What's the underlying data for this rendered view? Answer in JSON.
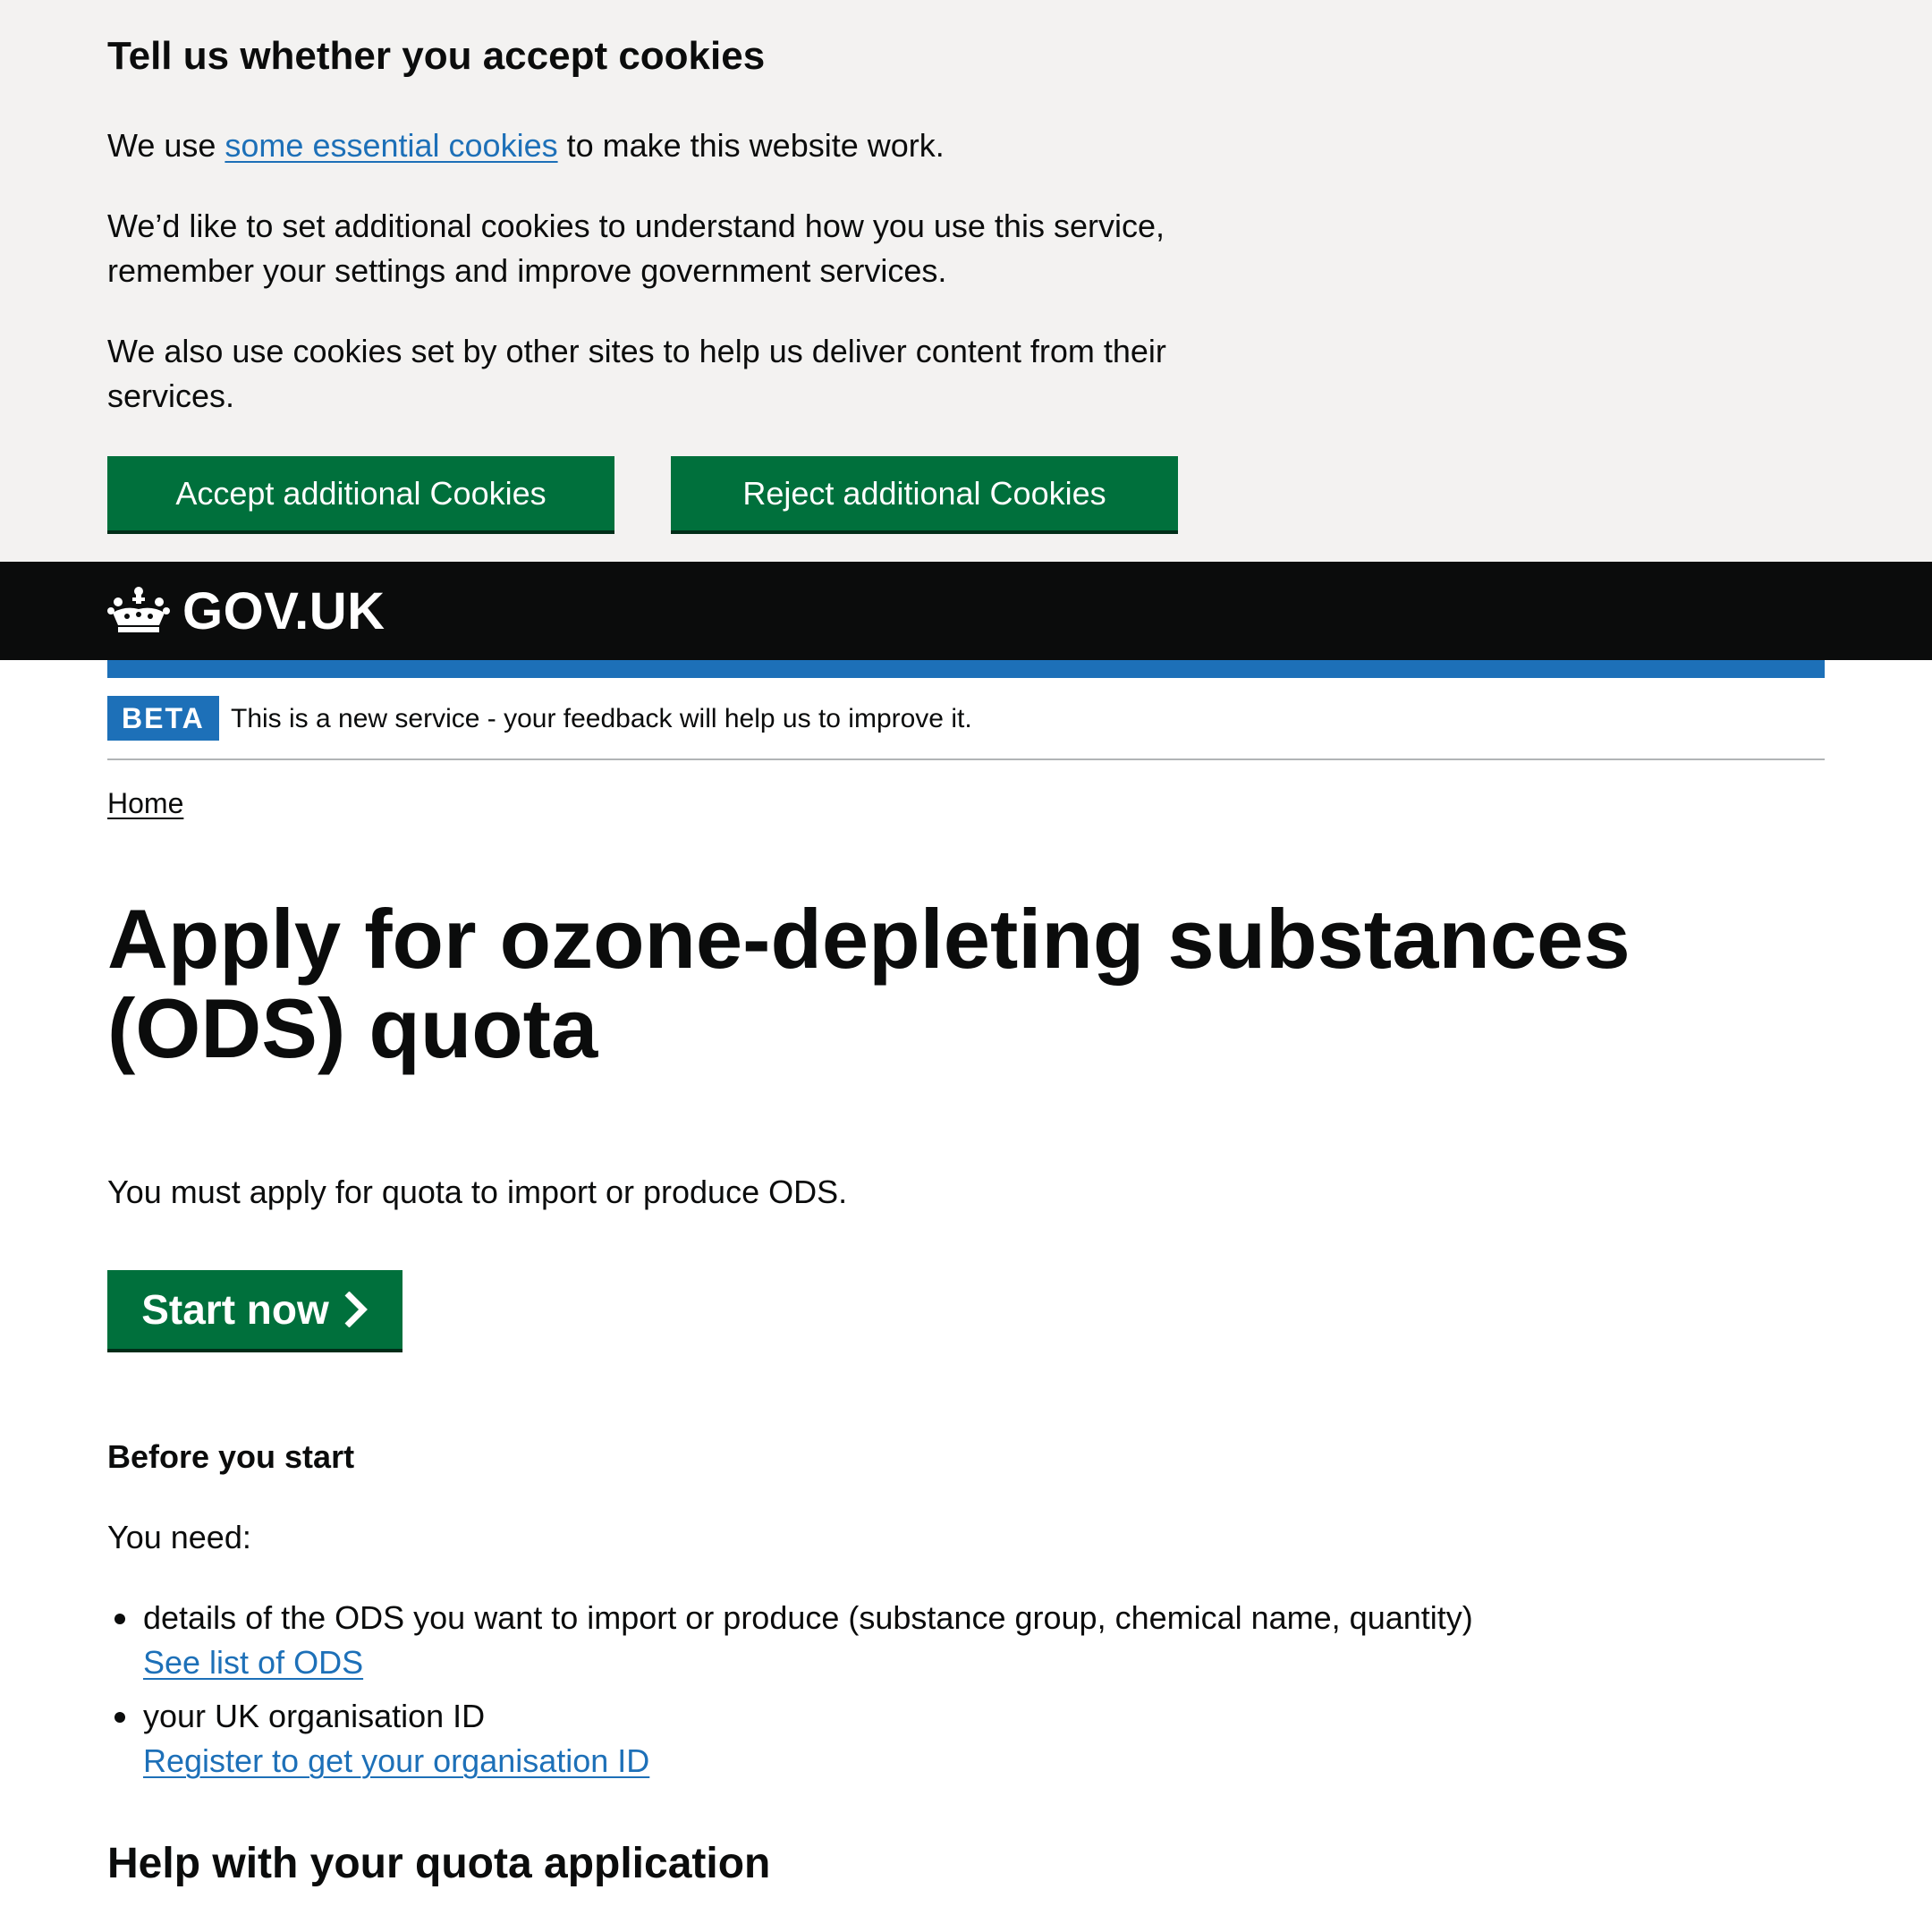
{
  "cookie_banner": {
    "title": "Tell us whether you accept cookies",
    "p1_before": "We use ",
    "p1_link": "some essential cookies",
    "p1_after": " to make this website work.",
    "p2": "We’d like to set additional cookies to understand how you use this service, remember your settings and improve government services.",
    "p3": "We also use cookies set by other sites to help us deliver content from their services.",
    "accept_label": "Accept additional Cookies",
    "reject_label": "Reject additional Cookies"
  },
  "header": {
    "logo_text": "GOV.UK",
    "logo_icon": "crown-icon"
  },
  "phase_banner": {
    "tag": "BETA",
    "text": "This is a new service - your feedback will help us to improve it."
  },
  "breadcrumb": {
    "home": "Home"
  },
  "main": {
    "title": "Apply for ozone-depleting substances (ODS) quota",
    "lead": "You must apply for quota to import or produce ODS.",
    "start_button": "Start now",
    "start_icon": "chevron-right-icon",
    "before_heading": "Before you start",
    "you_need": "You need:",
    "need_items": [
      {
        "text": "details of the ODS you want to import or produce (substance group, chemical name, quantity)",
        "link": "See list of ODS"
      },
      {
        "text": "your UK organisation ID",
        "link": "Register to get your organisation ID"
      }
    ],
    "help_heading": "Help with your quota application"
  },
  "colors": {
    "banner_bg": "#f3f2f1",
    "header_bg": "#0b0c0c",
    "brand_blue": "#1d70b8",
    "button_green": "#00703c",
    "link_blue": "#1d70b8"
  }
}
